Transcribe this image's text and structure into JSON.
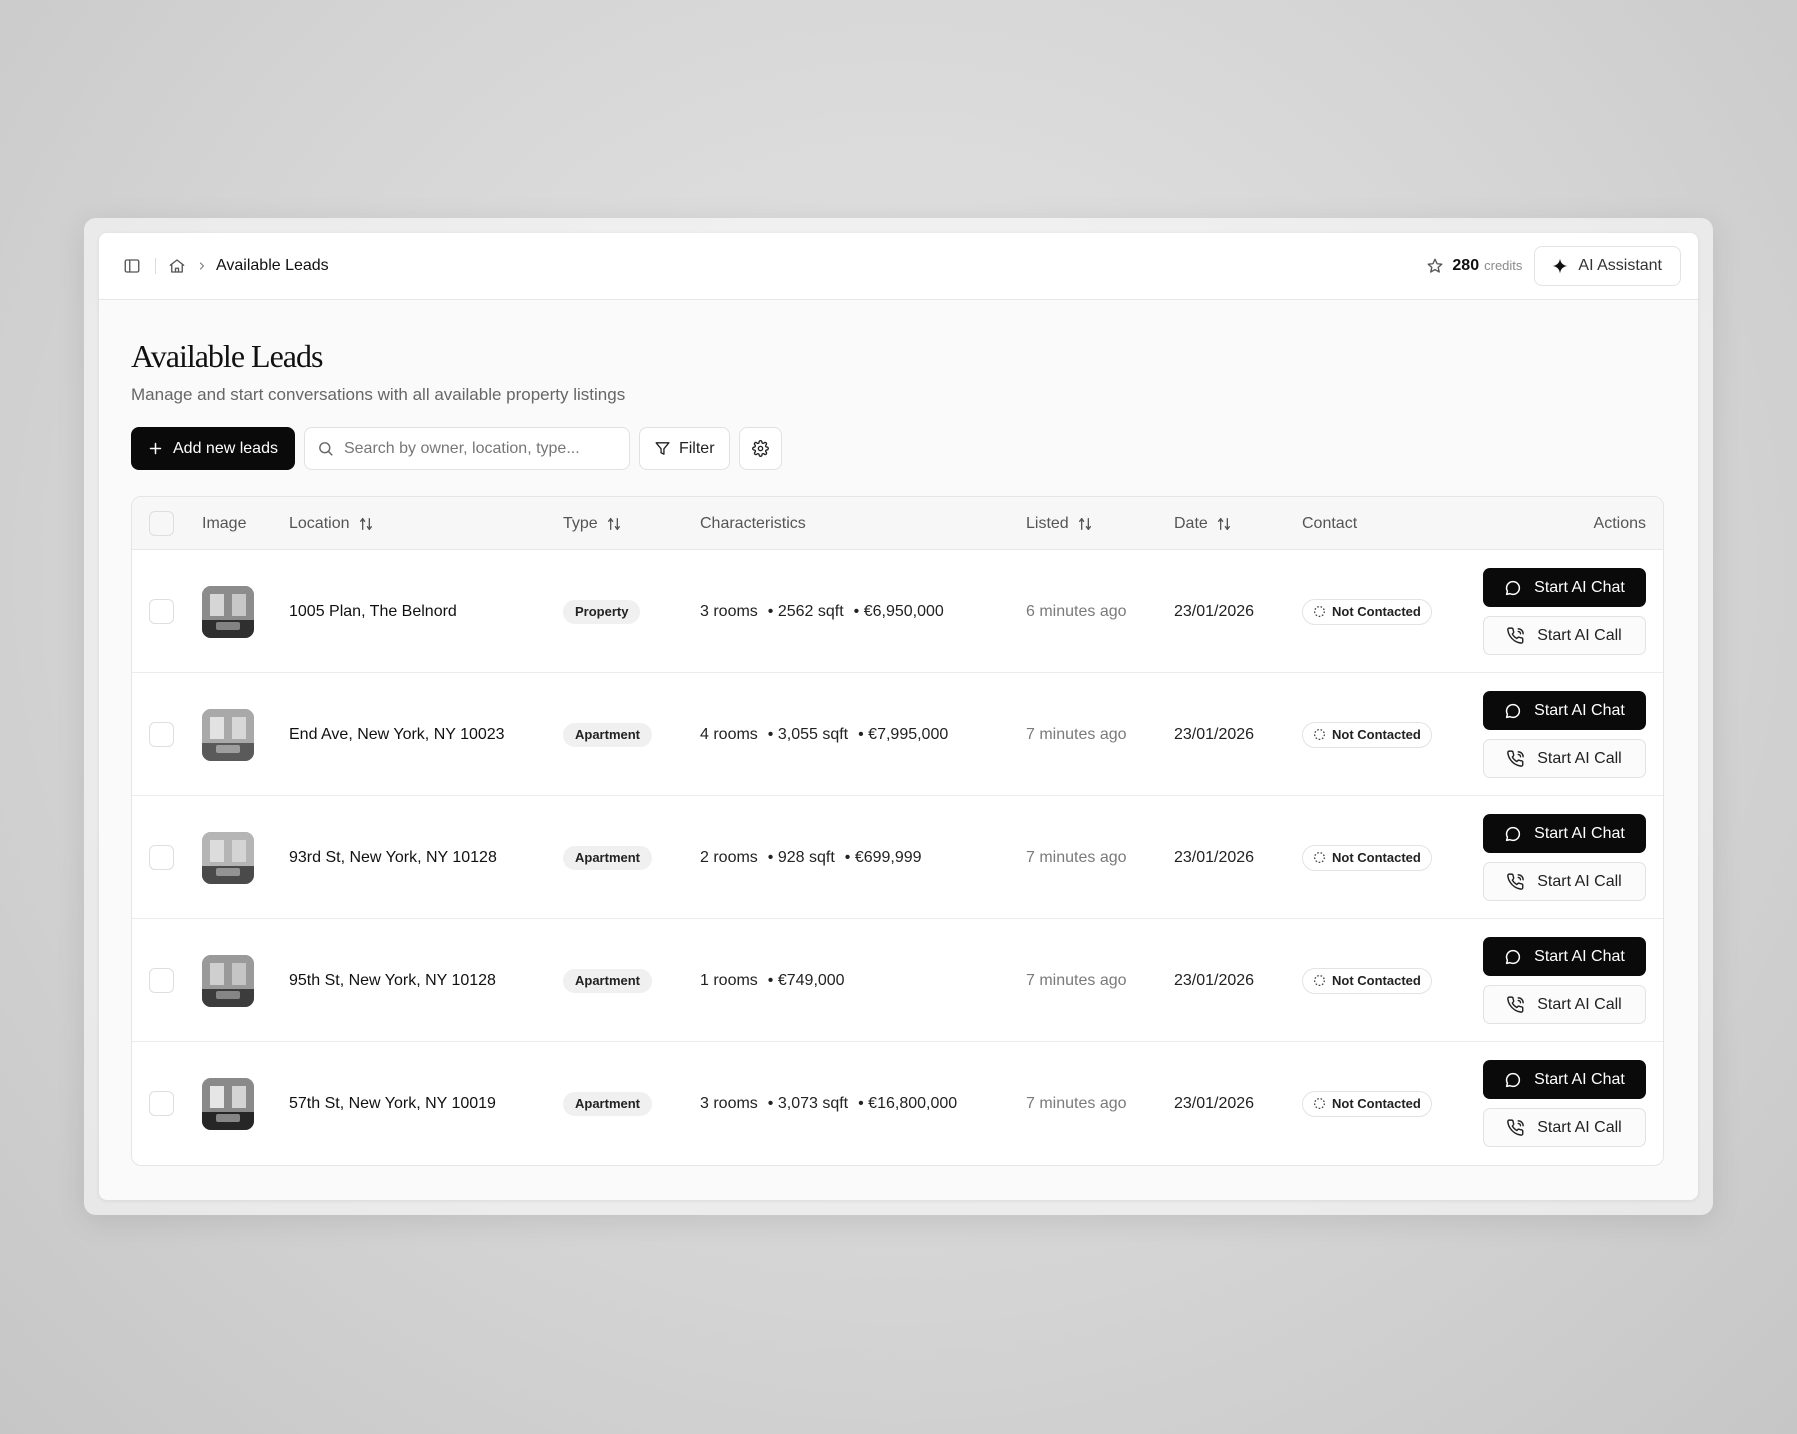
{
  "topbar": {
    "breadcrumb": "Available Leads",
    "credits_value": "280",
    "credits_label": "credits",
    "ai_assistant_label": "AI Assistant"
  },
  "page": {
    "title": "Available Leads",
    "subtitle": "Manage and start conversations with all available property listings"
  },
  "toolbar": {
    "add_label": "Add new leads",
    "search_placeholder": "Search by owner, location, type...",
    "filter_label": "Filter"
  },
  "table": {
    "headers": {
      "image": "Image",
      "location": "Location",
      "type": "Type",
      "characteristics": "Characteristics",
      "listed": "Listed",
      "date": "Date",
      "contact": "Contact",
      "actions": "Actions"
    },
    "action_labels": {
      "chat": "Start AI Chat",
      "call": "Start AI Call"
    },
    "rows": [
      {
        "location": "1005 Plan, The Belnord",
        "type": "Property",
        "characteristics": [
          "3 rooms",
          "2562 sqft",
          "€6,950,000"
        ],
        "listed": "6 minutes ago",
        "date": "23/01/2026",
        "contact": "Not Contacted"
      },
      {
        "location": "End Ave, New York, NY 10023",
        "type": "Apartment",
        "characteristics": [
          "4 rooms",
          "3,055 sqft",
          "€7,995,000"
        ],
        "listed": "7 minutes ago",
        "date": "23/01/2026",
        "contact": "Not Contacted"
      },
      {
        "location": "93rd St, New York, NY 10128",
        "type": "Apartment",
        "characteristics": [
          "2 rooms",
          "928 sqft",
          "€699,999"
        ],
        "listed": "7 minutes ago",
        "date": "23/01/2026",
        "contact": "Not Contacted"
      },
      {
        "location": "95th St, New York, NY 10128",
        "type": "Apartment",
        "characteristics": [
          "1 rooms",
          "€749,000"
        ],
        "listed": "7 minutes ago",
        "date": "23/01/2026",
        "contact": "Not Contacted"
      },
      {
        "location": "57th St, New York, NY 10019",
        "type": "Apartment",
        "characteristics": [
          "3 rooms",
          "3,073 sqft",
          "€16,800,000"
        ],
        "listed": "7 minutes ago",
        "date": "23/01/2026",
        "contact": "Not Contacted"
      }
    ]
  },
  "icons": {
    "sidebar_toggle": "sidebar-toggle-icon",
    "home": "home-icon",
    "chevron": "chevron-right-icon",
    "star": "star-icon",
    "sparkle": "sparkle-icon",
    "plus": "plus-icon",
    "search": "search-icon",
    "filter": "filter-icon",
    "settings": "gear-icon",
    "sort": "sort-arrows-icon",
    "chat": "chat-bubble-icon",
    "call": "phone-icon",
    "status": "dashed-circle-icon"
  },
  "colors": {
    "primary_button": "#0a0a0a",
    "background": "#fafafa",
    "badge_bg": "#f0f0f0"
  }
}
